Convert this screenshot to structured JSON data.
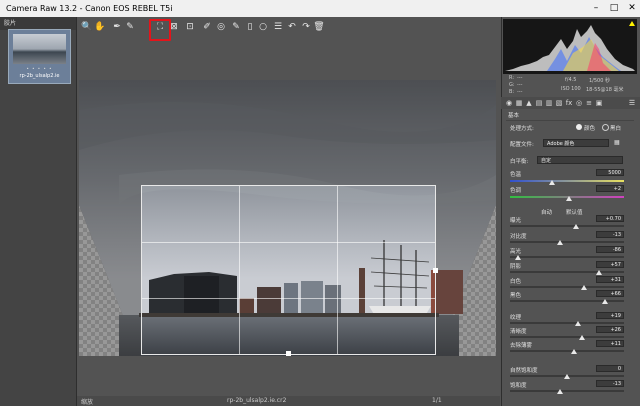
{
  "titlebar": {
    "title": "Camera Raw 13.2  -  Canon EOS REBEL T5i",
    "minimize": "–",
    "maximize": "□",
    "close": "✕"
  },
  "filmstrip": {
    "header": "胶片",
    "thumb_stars": "• • • • •",
    "thumb_filename": "rp-2b_ulsalp2.ie"
  },
  "toolbar": {
    "tools": [
      "zoom-icon",
      "hand-icon",
      "white-balance-icon",
      "color-sampler-icon",
      "crop-icon",
      "straighten-icon",
      "transform-icon",
      "spot-removal-icon",
      "redeye-icon",
      "adjustment-brush-icon",
      "graduated-filter-icon",
      "radial-filter-icon",
      "preferences-icon",
      "rotate-left-icon",
      "rotate-right-icon",
      "trash-icon"
    ],
    "glyphs": [
      "🔍",
      "✋",
      "✒",
      "✎",
      "⛶",
      "⊠",
      "⊡",
      "✐",
      "◎",
      "✎",
      "▯",
      "○",
      "☰",
      "↶",
      "↷",
      "🗑"
    ]
  },
  "exif": {
    "aperture": "f/4.5",
    "shutter": "1/500 秒",
    "iso": "ISO 100",
    "lens": "18-55@18 毫米",
    "r": "R:",
    "g": "G:",
    "b": "B:",
    "dashes": "---"
  },
  "basic": {
    "section_title": "基本",
    "treatment_label": "处理方式:",
    "treatment_color": "颜色",
    "treatment_bw": "黑白",
    "profile_label": "配置文件:",
    "profile_value": "Adobe 颜色",
    "wb_label": "白平衡:",
    "wb_value": "自定",
    "temp_label": "色温",
    "temp_value": "5000",
    "tint_label": "色调",
    "tint_value": "+2",
    "auto": "自动",
    "default": "默认值",
    "sliders": [
      {
        "label": "曝光",
        "value": "+0.70",
        "pos": 0.58
      },
      {
        "label": "对比度",
        "value": "-13",
        "pos": 0.44
      },
      {
        "label": "高光",
        "value": "-86",
        "pos": 0.07
      },
      {
        "label": "阴影",
        "value": "+57",
        "pos": 0.78
      },
      {
        "label": "白色",
        "value": "+31",
        "pos": 0.65
      },
      {
        "label": "黑色",
        "value": "+66",
        "pos": 0.83
      },
      {
        "label": "纹理",
        "value": "+19",
        "pos": 0.6
      },
      {
        "label": "清晰度",
        "value": "+26",
        "pos": 0.63
      },
      {
        "label": "去除薄雾",
        "value": "+11",
        "pos": 0.56
      },
      {
        "label": "自然饱和度",
        "value": "0",
        "pos": 0.5
      },
      {
        "label": "饱和度",
        "value": "-13",
        "pos": 0.44
      }
    ],
    "temp_pos": 0.37,
    "tint_pos": 0.52
  },
  "bottombar": {
    "filename": "rp-2b_ulsalp2.ie.cr2",
    "zoom": "缩放",
    "page": "1/1"
  },
  "colors": {
    "accent_red": "#e3141b",
    "panel": "#535353",
    "canvas": "#6a6a6a"
  }
}
